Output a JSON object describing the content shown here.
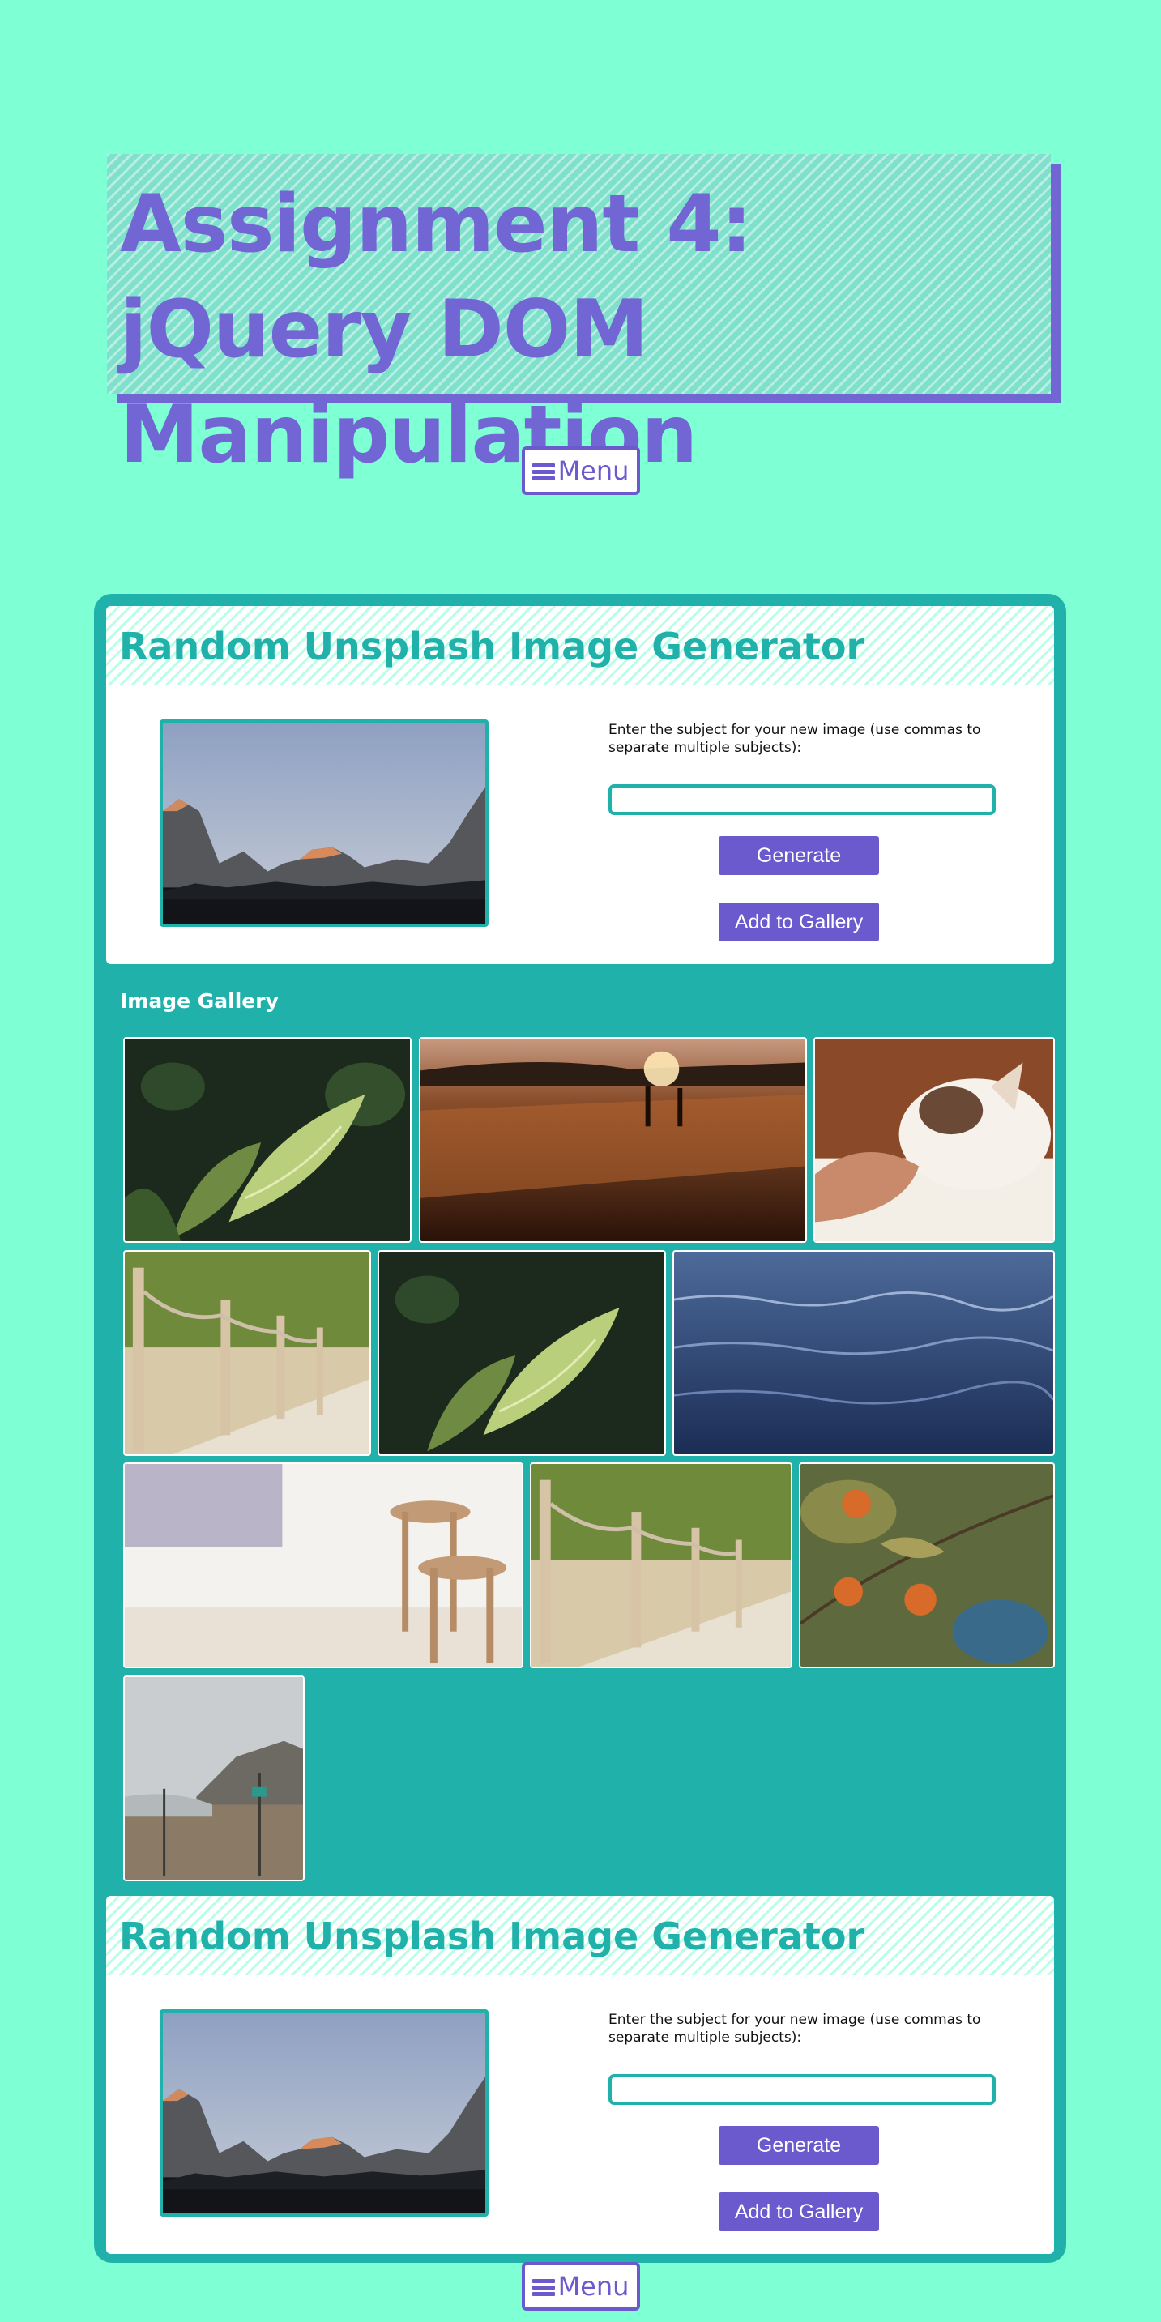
{
  "header": {
    "title": "Assignment 4: jQuery DOM Manipulation"
  },
  "nav": {
    "menu_label": "Menu",
    "menu_icon": "hamburger-menu-icon"
  },
  "generator": {
    "title": "Random Unsplash Image Generator",
    "label": "Enter the subject for your new image (use commas to separate multiple subjects):",
    "input_value": "",
    "generate_label": "Generate",
    "add_label": "Add to Gallery"
  },
  "gallery": {
    "heading": "Image Gallery",
    "images": [
      {
        "subject": "tropical-leaves"
      },
      {
        "subject": "sunset-pier"
      },
      {
        "subject": "cat-being-petted"
      },
      {
        "subject": "rope-boardwalk"
      },
      {
        "subject": "tropical-leaves"
      },
      {
        "subject": "ocean-water"
      },
      {
        "subject": "wooden-stools"
      },
      {
        "subject": "rope-boardwalk"
      },
      {
        "subject": "orange-tree"
      },
      {
        "subject": "foggy-beach"
      }
    ]
  },
  "colors": {
    "background": "#7fffd4",
    "accent_purple": "#6a5acd",
    "teal": "#20b2aa",
    "title_purple": "#7266d4"
  }
}
